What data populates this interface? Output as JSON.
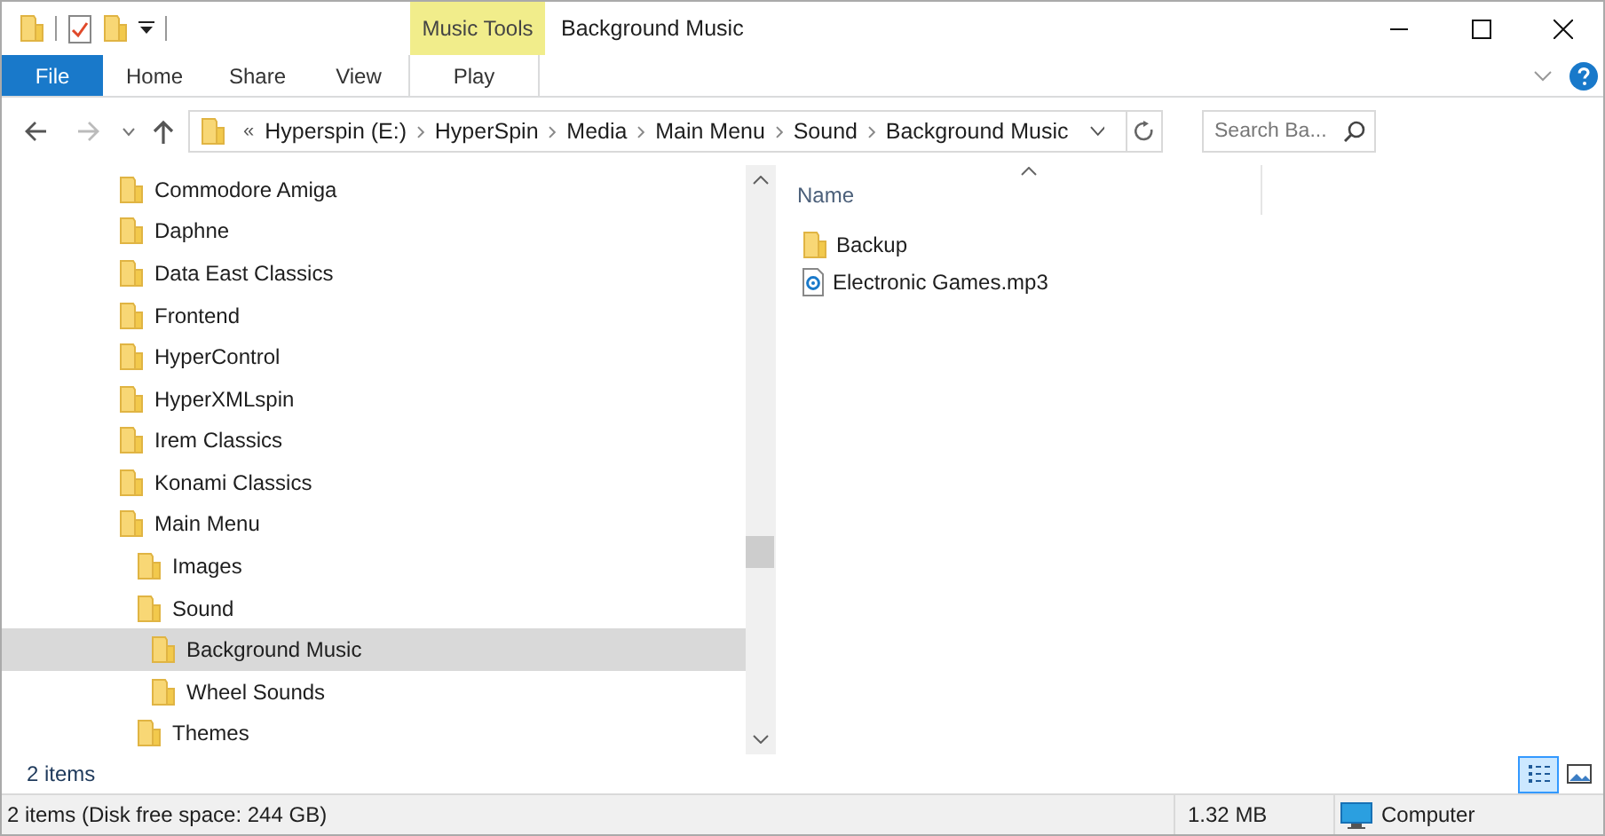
{
  "window": {
    "title": "Background Music"
  },
  "ribbon": {
    "file_tab": "File",
    "tabs": [
      "Home",
      "Share",
      "View"
    ],
    "context_group": {
      "label": "Music Tools",
      "tabs": [
        "Play"
      ]
    }
  },
  "address_bar": {
    "overflow": "«",
    "segments": [
      "Hyperspin (E:)",
      "HyperSpin",
      "Media",
      "Main Menu",
      "Sound",
      "Background Music"
    ]
  },
  "search": {
    "placeholder": "Search Ba..."
  },
  "navigation_tree": [
    {
      "label": "Commodore Amiga",
      "selected": false
    },
    {
      "label": "Daphne",
      "selected": false
    },
    {
      "label": "Data East Classics",
      "selected": false
    },
    {
      "label": "Frontend",
      "selected": false
    },
    {
      "label": "HyperControl",
      "selected": false
    },
    {
      "label": "HyperXMLspin",
      "selected": false
    },
    {
      "label": "Irem Classics",
      "selected": false
    },
    {
      "label": "Konami Classics",
      "selected": false
    },
    {
      "label": "Main Menu",
      "selected": false,
      "children": [
        {
          "label": "Images",
          "selected": false
        },
        {
          "label": "Sound",
          "selected": false,
          "children": [
            {
              "label": "Background Music",
              "selected": true
            },
            {
              "label": "Wheel Sounds",
              "selected": false
            }
          ]
        },
        {
          "label": "Themes",
          "selected": false
        }
      ]
    }
  ],
  "file_list": {
    "columns": [
      "Name"
    ],
    "items": [
      {
        "name": "Backup",
        "kind": "folder"
      },
      {
        "name": "Electronic Games.mp3",
        "kind": "audio"
      }
    ]
  },
  "item_count": "2 items",
  "view_buttons": [
    {
      "kind": "details",
      "selected": true
    },
    {
      "kind": "large-icons",
      "selected": false
    }
  ],
  "status_bar": {
    "summary": "2 items (Disk free space: 244 GB)",
    "size": "1.32 MB",
    "location": "Computer"
  }
}
